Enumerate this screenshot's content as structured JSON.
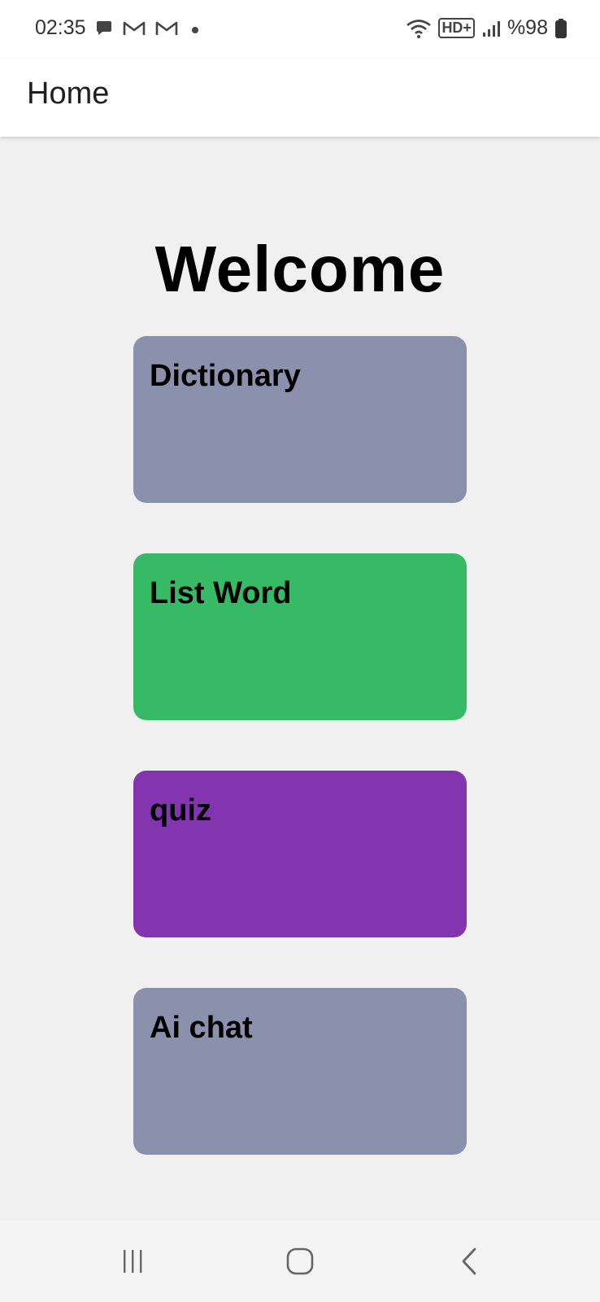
{
  "status_bar": {
    "time": "02:35",
    "network_label": "HD+",
    "battery": "%98",
    "notification_icons": [
      "chat-bubble-icon",
      "gmail-icon",
      "gmail-icon",
      "dot-icon"
    ],
    "system_icons": [
      "wifi-icon",
      "hd-plus-icon",
      "signal-icon",
      "battery-icon"
    ]
  },
  "app_bar": {
    "title": "Home"
  },
  "main": {
    "heading": "Welcome",
    "cards": [
      {
        "label": "Dictionary",
        "color": "#8b91ad"
      },
      {
        "label": "List Word",
        "color": "#37ba66"
      },
      {
        "label": "quiz",
        "color": "#8335af"
      },
      {
        "label": "Ai chat",
        "color": "#8b91ad"
      }
    ]
  },
  "nav_bar": {
    "buttons": [
      "recent-apps-icon",
      "home-icon",
      "back-icon"
    ]
  }
}
